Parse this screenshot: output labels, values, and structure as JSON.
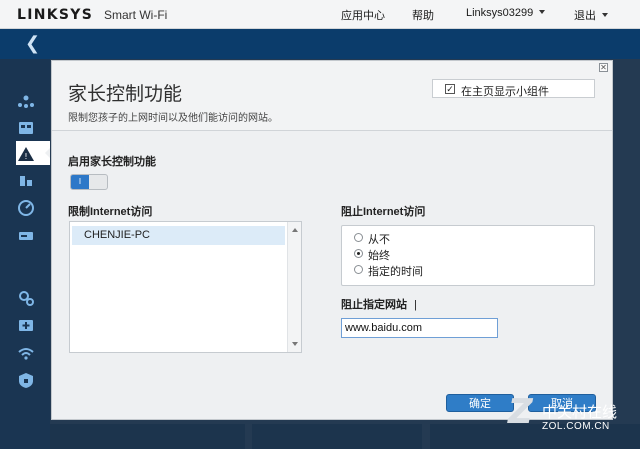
{
  "header": {
    "brand": "LINKSYS",
    "product": "Smart Wi-Fi",
    "nav": {
      "app_center": "应用中心",
      "help": "帮助",
      "account": "Linksys03299",
      "logout": "退出"
    }
  },
  "sidebar": {
    "icons": [
      "network-map-icon",
      "device-list-icon",
      "parental-controls-icon",
      "media-prioritization-icon",
      "speed-test-icon",
      "external-storage-icon",
      "connectivity-icon",
      "troubleshooting-icon",
      "wireless-icon",
      "security-icon"
    ],
    "active": "parental-controls-icon"
  },
  "panel": {
    "title": "家长控制功能",
    "description": "限制您孩子的上网时间以及他们能访问的网站。",
    "show_widget_label": "在主页显示小组件",
    "show_widget_checked": true,
    "enable_label": "启用家长控制功能",
    "toggle_text": "I",
    "restrict_label": "限制Internet访问",
    "devices": [
      "CHENJIE-PC"
    ],
    "block_label": "阻止Internet访问",
    "block_options": [
      {
        "label": "从不",
        "checked": false
      },
      {
        "label": "始终",
        "checked": true
      },
      {
        "label": "指定的时间",
        "checked": false
      }
    ],
    "block_sites_label": "阻止指定网站",
    "block_sites_cursor": "|",
    "site_value": "www.baidu.com",
    "ok_label": "确定",
    "cancel_label": "取消"
  },
  "watermark": {
    "logo": "Z",
    "name": "中关村在线",
    "url": "ZOL.COM.CN"
  },
  "colors": {
    "accent": "#2f7dc7",
    "band": "#0b3c6b",
    "sidebar": "#1a3552"
  }
}
